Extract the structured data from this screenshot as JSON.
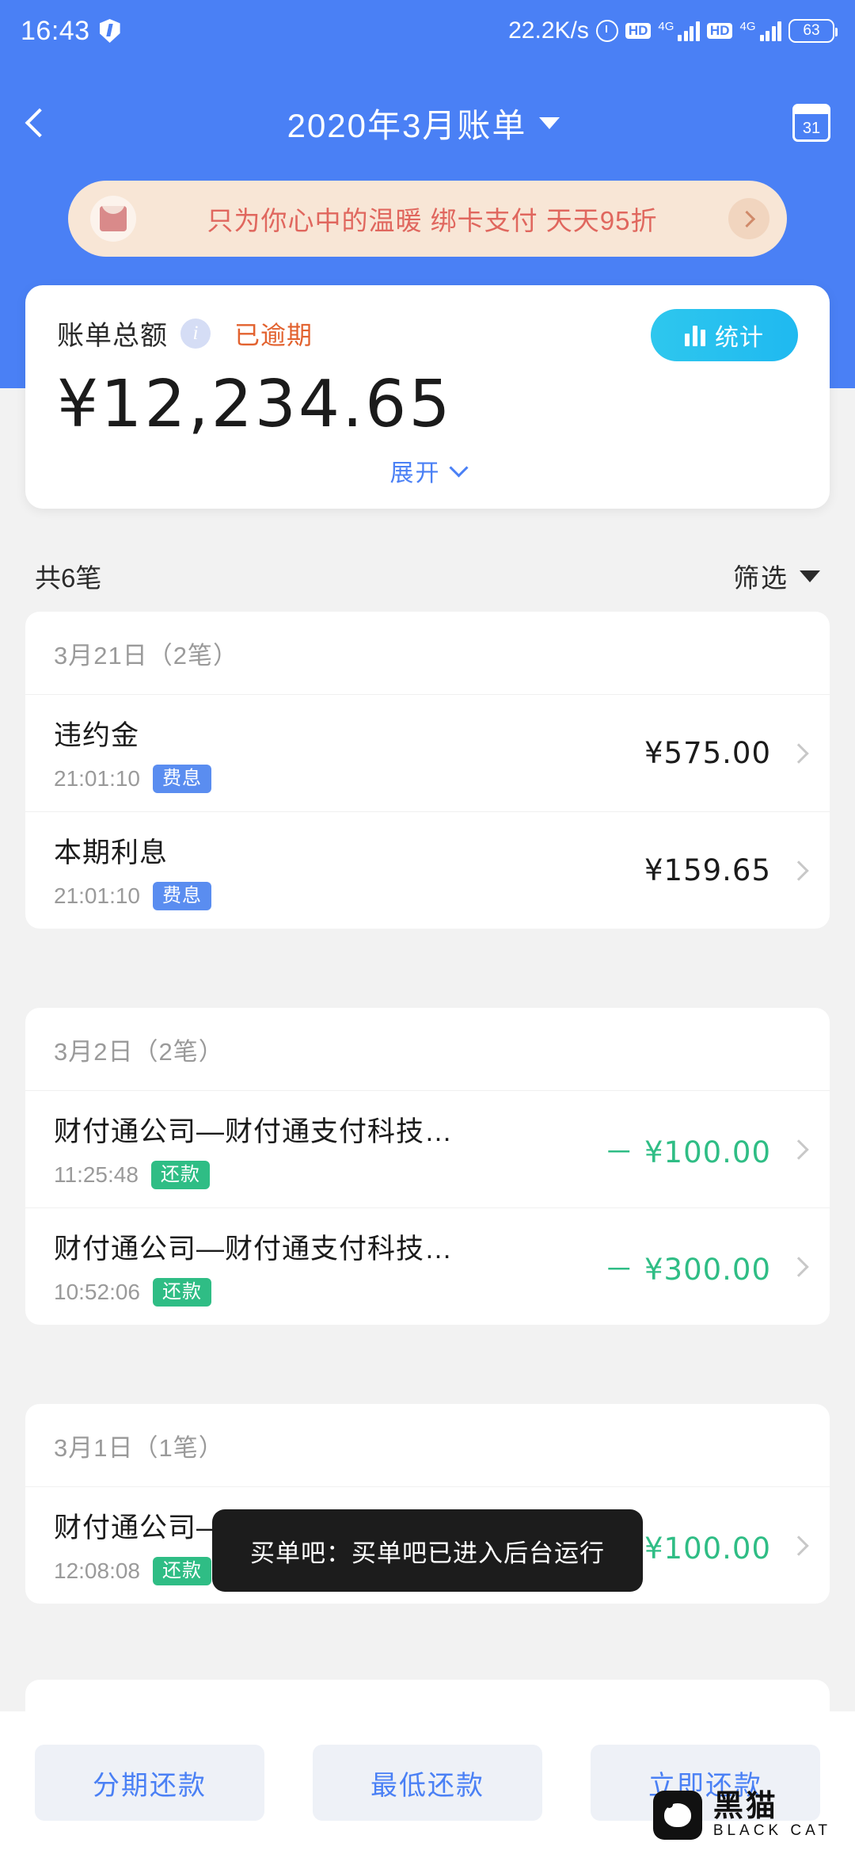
{
  "statusbar": {
    "clock": "16:43",
    "shield_icon": "shield-icon",
    "network_speed": "22.2K/s",
    "alarm_icon": "alarm-icon",
    "hd1": "HD",
    "net1": "4G",
    "hd2": "HD",
    "net2": "4G",
    "battery_percent": "63"
  },
  "titlebar": {
    "back_icon": "back-chevron-icon",
    "title": "2020年3月账单",
    "dropdown_icon": "chevron-down-icon",
    "calendar_icon": "calendar-icon",
    "calendar_day": "31"
  },
  "banner": {
    "envelope_icon": "red-envelope-icon",
    "text": "只为你心中的温暖 绑卡支付 天天95折",
    "arrow_icon": "chevron-right-icon"
  },
  "summary": {
    "label": "账单总额",
    "info_icon": "info-icon",
    "info_glyph": "i",
    "status": "已逾期",
    "status_color": "#e2622f",
    "stat_button": "统计",
    "stat_icon": "bar-chart-icon",
    "amount": "¥12,234.65",
    "expand_label": "展开",
    "expand_icon": "chevron-down-icon"
  },
  "listbar": {
    "count": "共6笔",
    "filter_label": "筛选",
    "filter_icon": "triangle-down-icon"
  },
  "groups": [
    {
      "header": "3月21日（2笔）",
      "items": [
        {
          "title": "违约金",
          "time": "21:01:10",
          "tag": "费息",
          "tag_type": "fee",
          "amount": "¥575.00",
          "amount_type": "dark"
        },
        {
          "title": "本期利息",
          "time": "21:01:10",
          "tag": "费息",
          "tag_type": "fee",
          "amount": "¥159.65",
          "amount_type": "dark"
        }
      ]
    },
    {
      "header": "3月2日（2笔）",
      "items": [
        {
          "title": "财付通公司—财付通支付科技…",
          "time": "11:25:48",
          "tag": "还款",
          "tag_type": "repay",
          "amount": "－ ¥100.00",
          "amount_type": "green"
        },
        {
          "title": "财付通公司—财付通支付科技…",
          "time": "10:52:06",
          "tag": "还款",
          "tag_type": "repay",
          "amount": "－ ¥300.00",
          "amount_type": "green"
        }
      ]
    },
    {
      "header": "3月1日（1笔）",
      "items": [
        {
          "title": "财付通公司—财付通支付科技…",
          "time": "12:08:08",
          "tag": "还款",
          "tag_type": "repay",
          "amount": "－ ¥100.00",
          "amount_type": "green"
        }
      ]
    }
  ],
  "toast": {
    "text": "买单吧：买单吧已进入后台运行"
  },
  "bottom": {
    "buttons": [
      {
        "label": "分期还款"
      },
      {
        "label": "最低还款"
      },
      {
        "label": "立即还款"
      }
    ]
  },
  "watermark": {
    "cn": "黑猫",
    "en": "BLACK CAT",
    "icon": "black-cat-logo-icon"
  },
  "colors": {
    "brand_blue": "#4a80f5",
    "green": "#2fbd85",
    "orange": "#e2622f",
    "banner_bg": "#f8e6d6"
  }
}
